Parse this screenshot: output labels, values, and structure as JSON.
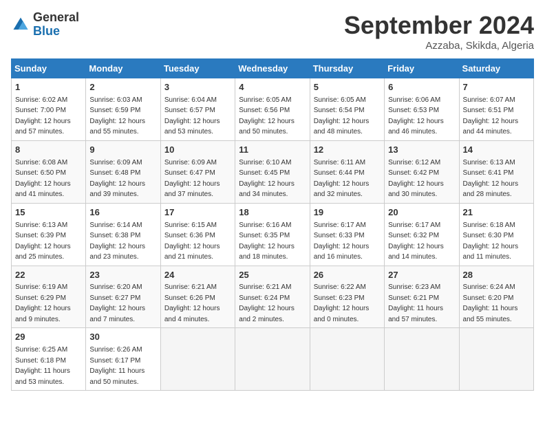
{
  "logo": {
    "general": "General",
    "blue": "Blue"
  },
  "header": {
    "month": "September 2024",
    "location": "Azzaba, Skikda, Algeria"
  },
  "weekdays": [
    "Sunday",
    "Monday",
    "Tuesday",
    "Wednesday",
    "Thursday",
    "Friday",
    "Saturday"
  ],
  "weeks": [
    [
      {
        "day": "1",
        "sunrise": "6:02 AM",
        "sunset": "7:00 PM",
        "daylight": "12 hours and 57 minutes."
      },
      {
        "day": "2",
        "sunrise": "6:03 AM",
        "sunset": "6:59 PM",
        "daylight": "12 hours and 55 minutes."
      },
      {
        "day": "3",
        "sunrise": "6:04 AM",
        "sunset": "6:57 PM",
        "daylight": "12 hours and 53 minutes."
      },
      {
        "day": "4",
        "sunrise": "6:05 AM",
        "sunset": "6:56 PM",
        "daylight": "12 hours and 50 minutes."
      },
      {
        "day": "5",
        "sunrise": "6:05 AM",
        "sunset": "6:54 PM",
        "daylight": "12 hours and 48 minutes."
      },
      {
        "day": "6",
        "sunrise": "6:06 AM",
        "sunset": "6:53 PM",
        "daylight": "12 hours and 46 minutes."
      },
      {
        "day": "7",
        "sunrise": "6:07 AM",
        "sunset": "6:51 PM",
        "daylight": "12 hours and 44 minutes."
      }
    ],
    [
      {
        "day": "8",
        "sunrise": "6:08 AM",
        "sunset": "6:50 PM",
        "daylight": "12 hours and 41 minutes."
      },
      {
        "day": "9",
        "sunrise": "6:09 AM",
        "sunset": "6:48 PM",
        "daylight": "12 hours and 39 minutes."
      },
      {
        "day": "10",
        "sunrise": "6:09 AM",
        "sunset": "6:47 PM",
        "daylight": "12 hours and 37 minutes."
      },
      {
        "day": "11",
        "sunrise": "6:10 AM",
        "sunset": "6:45 PM",
        "daylight": "12 hours and 34 minutes."
      },
      {
        "day": "12",
        "sunrise": "6:11 AM",
        "sunset": "6:44 PM",
        "daylight": "12 hours and 32 minutes."
      },
      {
        "day": "13",
        "sunrise": "6:12 AM",
        "sunset": "6:42 PM",
        "daylight": "12 hours and 30 minutes."
      },
      {
        "day": "14",
        "sunrise": "6:13 AM",
        "sunset": "6:41 PM",
        "daylight": "12 hours and 28 minutes."
      }
    ],
    [
      {
        "day": "15",
        "sunrise": "6:13 AM",
        "sunset": "6:39 PM",
        "daylight": "12 hours and 25 minutes."
      },
      {
        "day": "16",
        "sunrise": "6:14 AM",
        "sunset": "6:38 PM",
        "daylight": "12 hours and 23 minutes."
      },
      {
        "day": "17",
        "sunrise": "6:15 AM",
        "sunset": "6:36 PM",
        "daylight": "12 hours and 21 minutes."
      },
      {
        "day": "18",
        "sunrise": "6:16 AM",
        "sunset": "6:35 PM",
        "daylight": "12 hours and 18 minutes."
      },
      {
        "day": "19",
        "sunrise": "6:17 AM",
        "sunset": "6:33 PM",
        "daylight": "12 hours and 16 minutes."
      },
      {
        "day": "20",
        "sunrise": "6:17 AM",
        "sunset": "6:32 PM",
        "daylight": "12 hours and 14 minutes."
      },
      {
        "day": "21",
        "sunrise": "6:18 AM",
        "sunset": "6:30 PM",
        "daylight": "12 hours and 11 minutes."
      }
    ],
    [
      {
        "day": "22",
        "sunrise": "6:19 AM",
        "sunset": "6:29 PM",
        "daylight": "12 hours and 9 minutes."
      },
      {
        "day": "23",
        "sunrise": "6:20 AM",
        "sunset": "6:27 PM",
        "daylight": "12 hours and 7 minutes."
      },
      {
        "day": "24",
        "sunrise": "6:21 AM",
        "sunset": "6:26 PM",
        "daylight": "12 hours and 4 minutes."
      },
      {
        "day": "25",
        "sunrise": "6:21 AM",
        "sunset": "6:24 PM",
        "daylight": "12 hours and 2 minutes."
      },
      {
        "day": "26",
        "sunrise": "6:22 AM",
        "sunset": "6:23 PM",
        "daylight": "12 hours and 0 minutes."
      },
      {
        "day": "27",
        "sunrise": "6:23 AM",
        "sunset": "6:21 PM",
        "daylight": "11 hours and 57 minutes."
      },
      {
        "day": "28",
        "sunrise": "6:24 AM",
        "sunset": "6:20 PM",
        "daylight": "11 hours and 55 minutes."
      }
    ],
    [
      {
        "day": "29",
        "sunrise": "6:25 AM",
        "sunset": "6:18 PM",
        "daylight": "11 hours and 53 minutes."
      },
      {
        "day": "30",
        "sunrise": "6:26 AM",
        "sunset": "6:17 PM",
        "daylight": "11 hours and 50 minutes."
      },
      null,
      null,
      null,
      null,
      null
    ]
  ]
}
